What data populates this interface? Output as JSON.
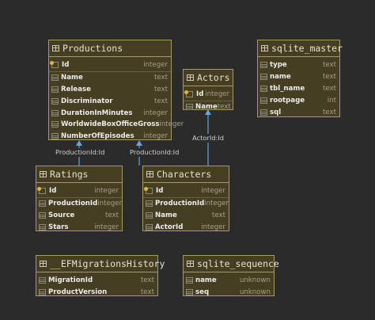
{
  "tables": {
    "productions": {
      "name": "Productions",
      "columns": [
        {
          "name": "Id",
          "type": "integer"
        },
        {
          "name": "Name",
          "type": "text"
        },
        {
          "name": "Release",
          "type": "text"
        },
        {
          "name": "Discriminator",
          "type": "text"
        },
        {
          "name": "DurationInMinutes",
          "type": "integer"
        },
        {
          "name": "WorldwideBoxOfficeGross",
          "type": "integer"
        },
        {
          "name": "NumberOfEpisodes",
          "type": "integer"
        }
      ]
    },
    "actors": {
      "name": "Actors",
      "columns": [
        {
          "name": "Id",
          "type": "integer"
        },
        {
          "name": "Name",
          "type": "text"
        }
      ]
    },
    "sqlite_master": {
      "name": "sqlite_master",
      "columns": [
        {
          "name": "type",
          "type": "text"
        },
        {
          "name": "name",
          "type": "text"
        },
        {
          "name": "tbl_name",
          "type": "text"
        },
        {
          "name": "rootpage",
          "type": "int"
        },
        {
          "name": "sql",
          "type": "text"
        }
      ]
    },
    "ratings": {
      "name": "Ratings",
      "columns": [
        {
          "name": "Id",
          "type": "integer"
        },
        {
          "name": "ProductionId",
          "type": "integer"
        },
        {
          "name": "Source",
          "type": "text"
        },
        {
          "name": "Stars",
          "type": "integer"
        }
      ]
    },
    "characters": {
      "name": "Characters",
      "columns": [
        {
          "name": "Id",
          "type": "integer"
        },
        {
          "name": "ProductionId",
          "type": "integer"
        },
        {
          "name": "Name",
          "type": "text"
        },
        {
          "name": "ActorId",
          "type": "integer"
        }
      ]
    },
    "ef_migrations_history": {
      "name": "__EFMigrationsHistory",
      "columns": [
        {
          "name": "MigrationId",
          "type": "text"
        },
        {
          "name": "ProductVersion",
          "type": "text"
        }
      ]
    },
    "sqlite_sequence": {
      "name": "sqlite_sequence",
      "columns": [
        {
          "name": "name",
          "type": "unknown"
        },
        {
          "name": "seq",
          "type": "unknown"
        }
      ]
    }
  },
  "relations": {
    "ratings_production": "ProductionId:Id",
    "characters_production": "ProductionId:Id",
    "characters_actor": "ActorId:Id"
  },
  "colors": {
    "background": "#2b2b2b",
    "table_fill": "#453e22",
    "table_border": "#a69a64",
    "connector": "#5fa6e8",
    "primary_key": "#e2b53c"
  }
}
